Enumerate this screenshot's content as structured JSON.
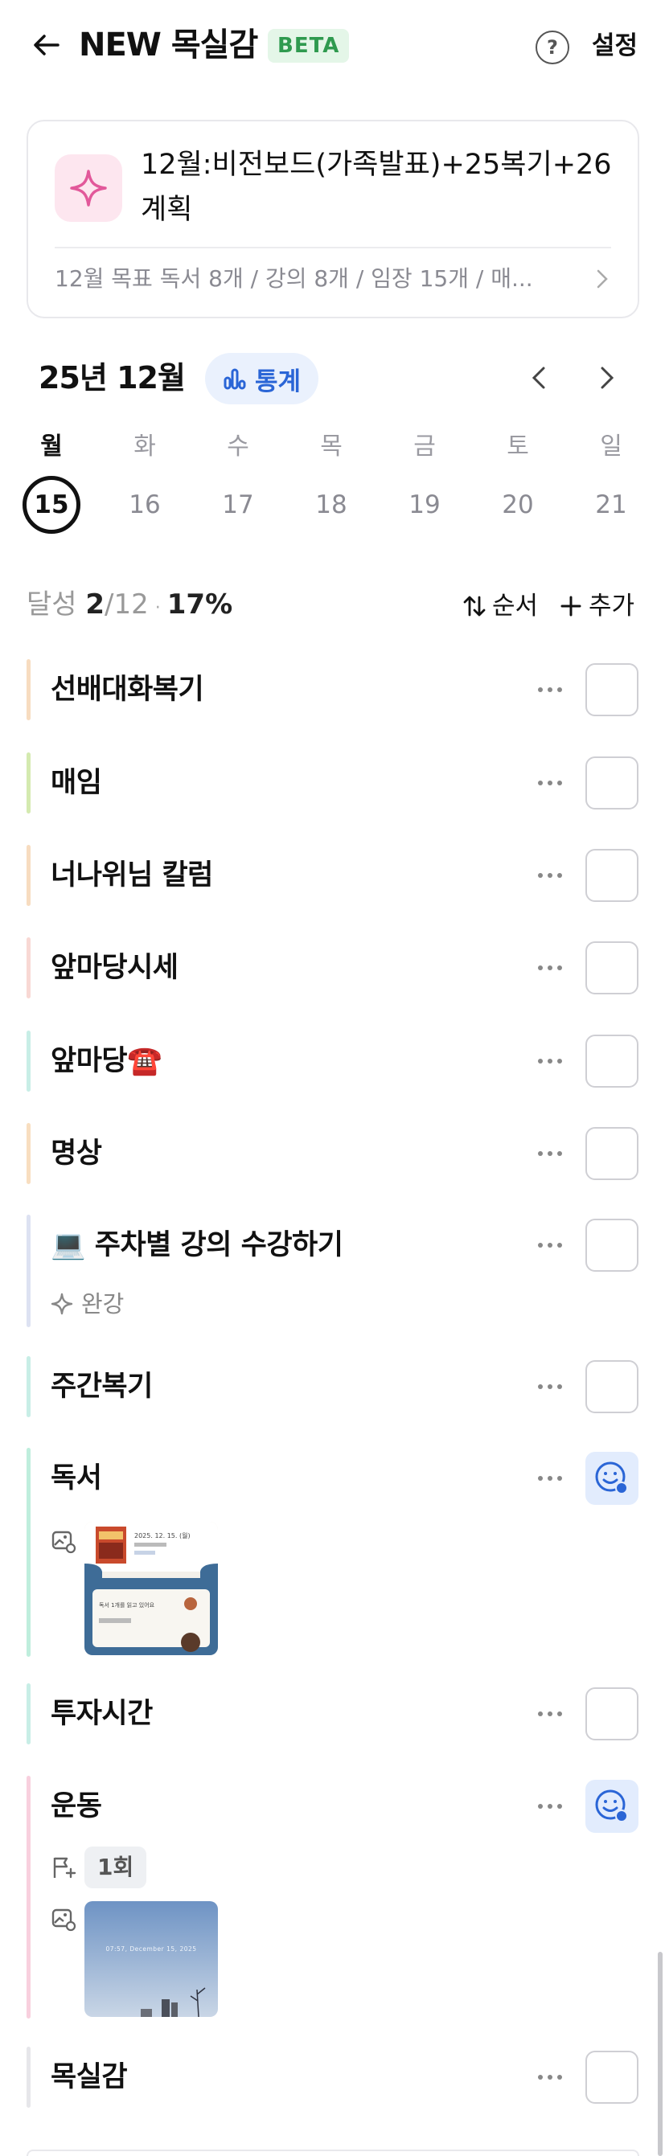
{
  "header": {
    "title": "NEW 목실감",
    "badge": "BETA",
    "help_glyph": "?",
    "settings_label": "설정"
  },
  "goal": {
    "title": "12월:비전보드(가족발표)+25복기+26계획",
    "subtitle": "12월 목표  독서 8개 / 강의 8개 / 임장 15개 / 매...",
    "icon": "sparkle-icon",
    "accent": "#e2589a"
  },
  "calendar": {
    "month_label": "25년 12월",
    "stats_label": "통계",
    "days": [
      {
        "name": "월",
        "date": "15",
        "selected": true
      },
      {
        "name": "화",
        "date": "16",
        "selected": false
      },
      {
        "name": "수",
        "date": "17",
        "selected": false
      },
      {
        "name": "목",
        "date": "18",
        "selected": false
      },
      {
        "name": "금",
        "date": "19",
        "selected": false
      },
      {
        "name": "토",
        "date": "20",
        "selected": false
      },
      {
        "name": "일",
        "date": "21",
        "selected": false
      }
    ]
  },
  "progress": {
    "label": "달성",
    "done": "2",
    "total": "/12",
    "sep": "·",
    "percent": "17%",
    "order_label": "순서",
    "add_label": "추가"
  },
  "tasks": [
    {
      "name": "선배대화복기",
      "color": "#f7dcc0",
      "done": false
    },
    {
      "name": "매임",
      "color": "#d4eab0",
      "done": false
    },
    {
      "name": "너나위님 칼럼",
      "color": "#f7dcc0",
      "done": false
    },
    {
      "name": "앞마당시세",
      "color": "#f8d8d4",
      "done": false
    },
    {
      "name": "앞마당☎️",
      "color": "#c8eee6",
      "done": false
    },
    {
      "name": "명상",
      "color": "#f8dec0",
      "done": false
    },
    {
      "name": "💻 주차별 강의 수강하기",
      "color": "#dde2f2",
      "done": false,
      "note": "완강"
    },
    {
      "name": "주간복기",
      "color": "#c8eee6",
      "done": false
    },
    {
      "name": "독서",
      "color": "#bfeedd",
      "done": true
    },
    {
      "name": "투자시간",
      "color": "#c8eee6",
      "done": false
    },
    {
      "name": "운동",
      "color": "#f8d0de",
      "done": true,
      "count": "1회"
    },
    {
      "name": "목실감",
      "color": "#e6e6ea",
      "done": false
    }
  ],
  "thumbs": {
    "reading": {
      "line1": "2025. 12. 15. (월)",
      "line2": "독서 1개를 읽고 있어요"
    },
    "exercise": {
      "line1": "07:57, December 15, 2025"
    }
  },
  "colors": {
    "accent_blue": "#2a65d6",
    "beta_green": "#2f9a4f"
  }
}
